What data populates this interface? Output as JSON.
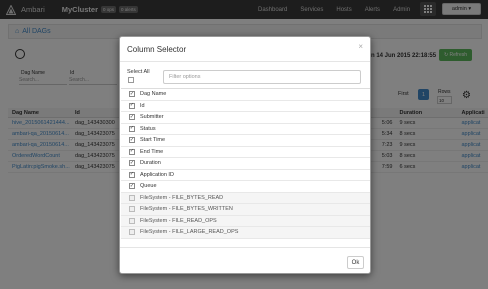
{
  "navbar": {
    "brand": "Ambari",
    "cluster": "MyCluster",
    "ops_badge": "0 ops",
    "alerts_badge": "0 alerts",
    "links": [
      "Dashboard",
      "Services",
      "Hosts",
      "Alerts",
      "Admin"
    ],
    "user_button": "admin ▾"
  },
  "breadcrumb": {
    "home_icon": "home-icon",
    "label": "All DAGs"
  },
  "toolbar": {
    "date_range": "n 14 Jun 2015 22:18:55",
    "refresh_label": "Refresh"
  },
  "filters": {
    "dag_name_label": "Dag Name",
    "dag_name_placeholder": "Search...",
    "id_label": "Id",
    "id_placeholder": "Search..."
  },
  "pager": {
    "first_label": "First",
    "page": "1",
    "rows_label": "Rows",
    "rows_value": "10"
  },
  "table": {
    "headers": {
      "name": "Dag Name",
      "id": "Id",
      "duration": "Duration",
      "app": "Applicati"
    },
    "rows": [
      {
        "name": "hive_2015061421444...",
        "id": "dag_143430300",
        "end": "5:06",
        "duration": "9 secs",
        "app": "applicat"
      },
      {
        "name": "ambari-qa_20150614...",
        "id": "dag_143423075",
        "end": "5:34",
        "duration": "8 secs",
        "app": "applicat"
      },
      {
        "name": "ambari-qa_20150614...",
        "id": "dag_143423075",
        "end": "7:23",
        "duration": "9 secs",
        "app": "applicat"
      },
      {
        "name": "OrderedWordCount",
        "id": "dag_143423075",
        "end": "5:03",
        "duration": "8 secs",
        "app": "applicat"
      },
      {
        "name": "PigLatin:pigSmoke.sh...",
        "id": "dag_143423075",
        "end": "7:59",
        "duration": "6 secs",
        "app": "applicat"
      }
    ]
  },
  "modal": {
    "title": "Column Selector",
    "close": "×",
    "select_all_label": "Select All",
    "filter_placeholder": "Filter options",
    "columns": [
      {
        "label": "Dag Name",
        "checked": true
      },
      {
        "label": "Id",
        "checked": true
      },
      {
        "label": "Submitter",
        "checked": true
      },
      {
        "label": "Status",
        "checked": true
      },
      {
        "label": "Start Time",
        "checked": true
      },
      {
        "label": "End Time",
        "checked": true
      },
      {
        "label": "Duration",
        "checked": true
      },
      {
        "label": "Application ID",
        "checked": true
      },
      {
        "label": "Queue",
        "checked": true
      },
      {
        "label": "FileSystem - FILE_BYTES_READ",
        "checked": false
      },
      {
        "label": "FileSystem - FILE_BYTES_WRITTEN",
        "checked": false
      },
      {
        "label": "FileSystem - FILE_READ_OPS",
        "checked": false
      },
      {
        "label": "FileSystem - FILE_LARGE_READ_OPS",
        "checked": false
      }
    ],
    "ok_label": "Ok"
  },
  "colors": {
    "navbar": "#3a3a3a",
    "link": "#428bca",
    "refresh": "#5cb85c",
    "overlay": "rgba(0,0,0,0.5)"
  }
}
